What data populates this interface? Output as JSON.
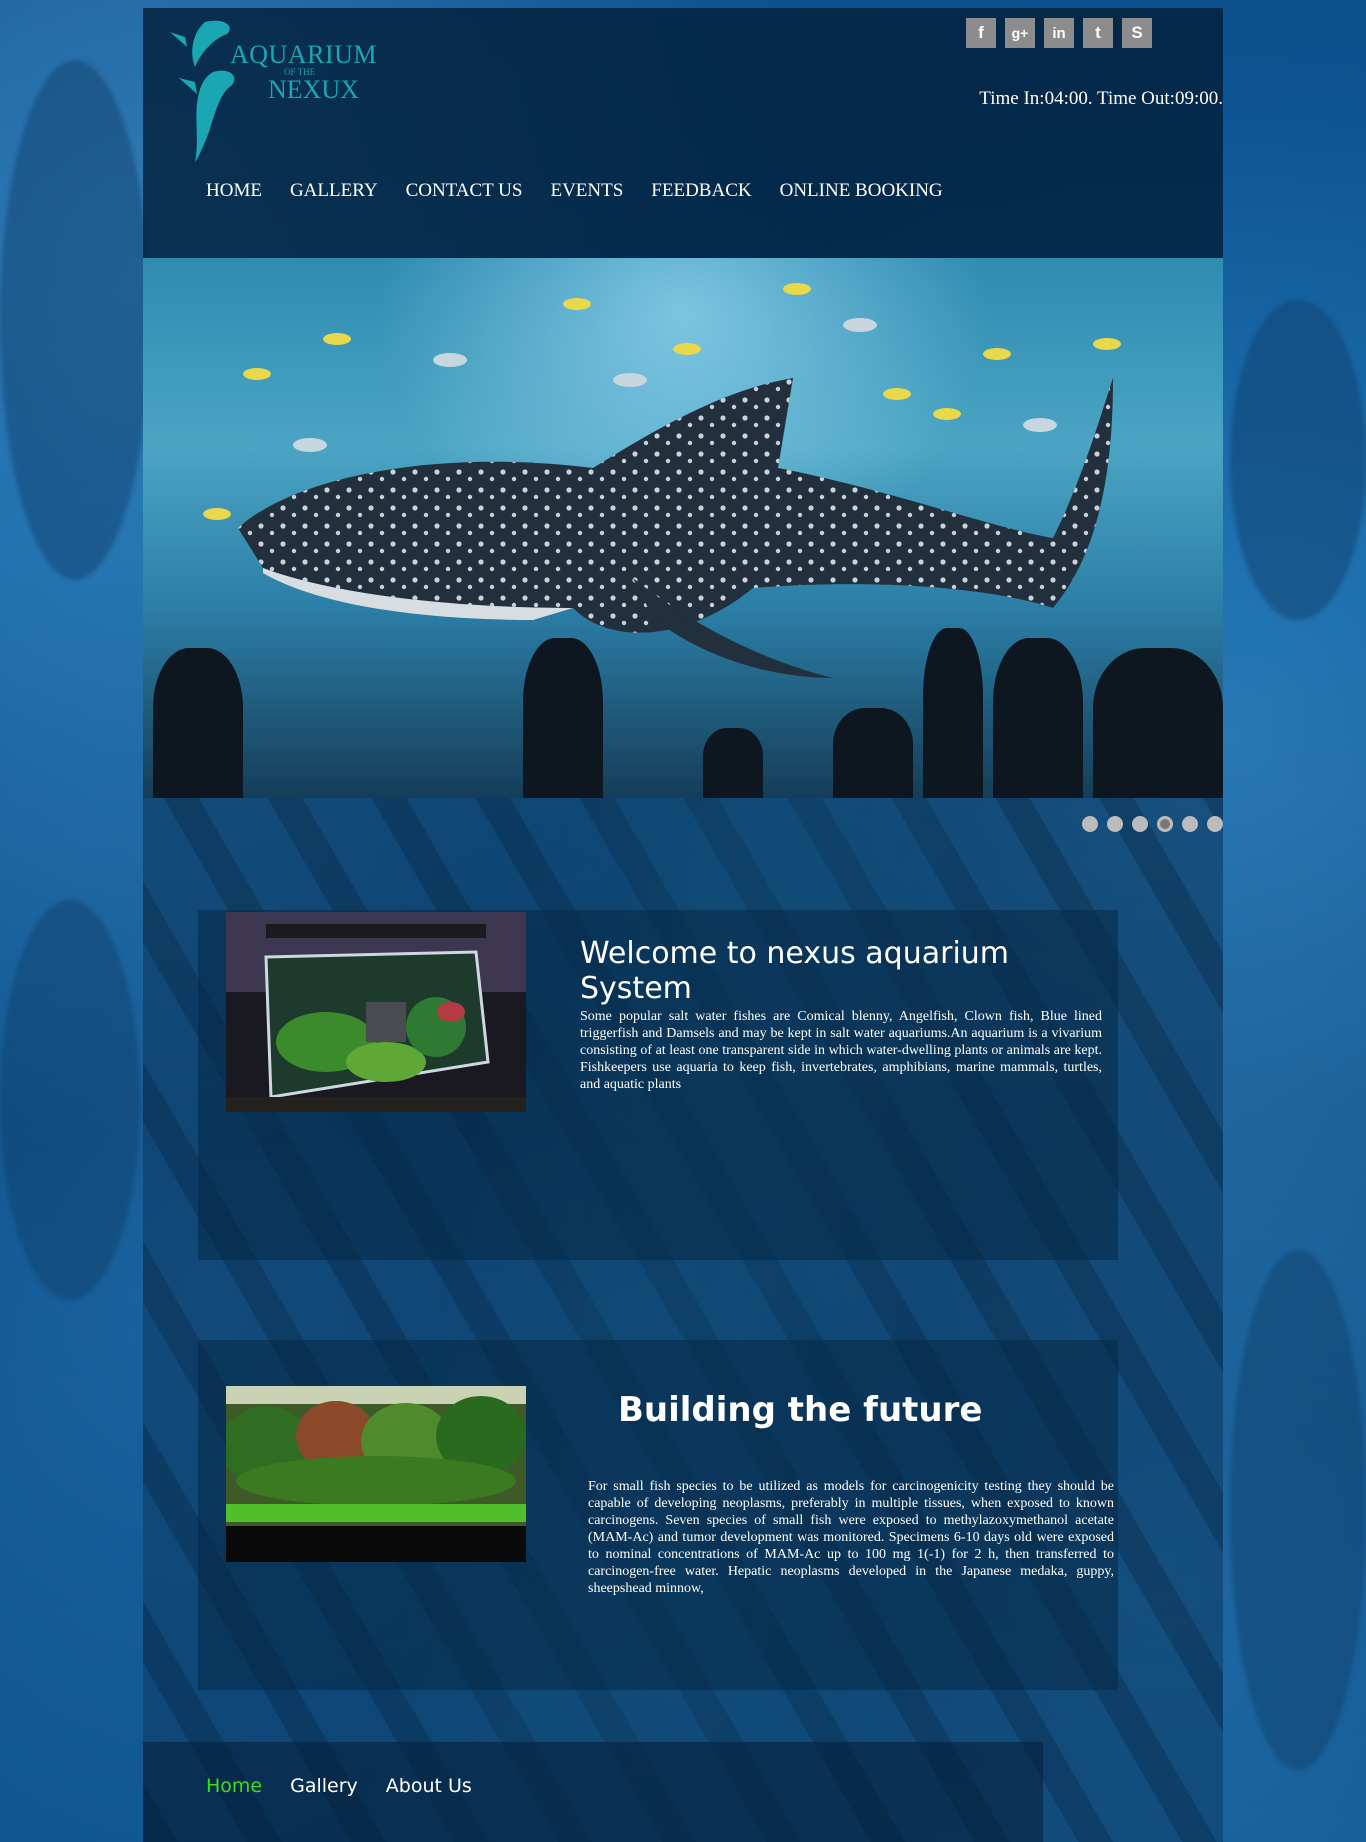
{
  "brand": {
    "logo_line1": "AQUARIUM",
    "logo_line2": "OF THE",
    "logo_line3": "NEXUX",
    "logo_color": "#1aa6b3"
  },
  "header": {
    "hours": "Time In:04:00. Time Out:09:00."
  },
  "social": [
    {
      "name": "facebook-icon",
      "glyph": "f"
    },
    {
      "name": "google-plus-icon",
      "glyph": "g+"
    },
    {
      "name": "linkedin-icon",
      "glyph": "in"
    },
    {
      "name": "twitter-icon",
      "glyph": "t"
    },
    {
      "name": "skype-icon",
      "glyph": "S"
    }
  ],
  "nav": {
    "home": "HOME",
    "gallery": "GALLERY",
    "contact": "CONTACT US",
    "events": "EVENTS",
    "feedback": "FEEDBACK",
    "booking": "ONLINE BOOKING"
  },
  "slider": {
    "slide_count": 6,
    "active_slide": 4
  },
  "welcome": {
    "title": "Welcome to nexus aquarium System",
    "text": "Some popular salt water fishes are Comical blenny, Angelfish, Clown fish, Blue lined triggerfish and Damsels and may be kept in salt water aquariums.An aquarium is a vivarium consisting of at least one transparent side in which water-dwelling plants or animals are kept. Fishkeepers use aquaria to keep fish, invertebrates, amphibians, marine mammals, turtles, and aquatic plants"
  },
  "future": {
    "title": "Building the future",
    "text": "For small fish species to be utilized as models for carcinogenicity testing they should be capable of developing neoplasms, preferably in multiple tissues, when exposed to known carcinogens. Seven species of small fish were exposed to methylazoxymethanol acetate (MAM-Ac) and tumor development was monitored. Specimens 6-10 days old were exposed to nominal concentrations of MAM-Ac up to 100 mg 1(-1) for 2 h, then transferred to carcinogen-free water. Hepatic neoplasms developed in the Japanese medaka, guppy, sheepshead minnow,"
  },
  "footer": {
    "home": "Home",
    "gallery": "Gallery",
    "about": "About Us",
    "active_color": "#3ddc1e"
  }
}
